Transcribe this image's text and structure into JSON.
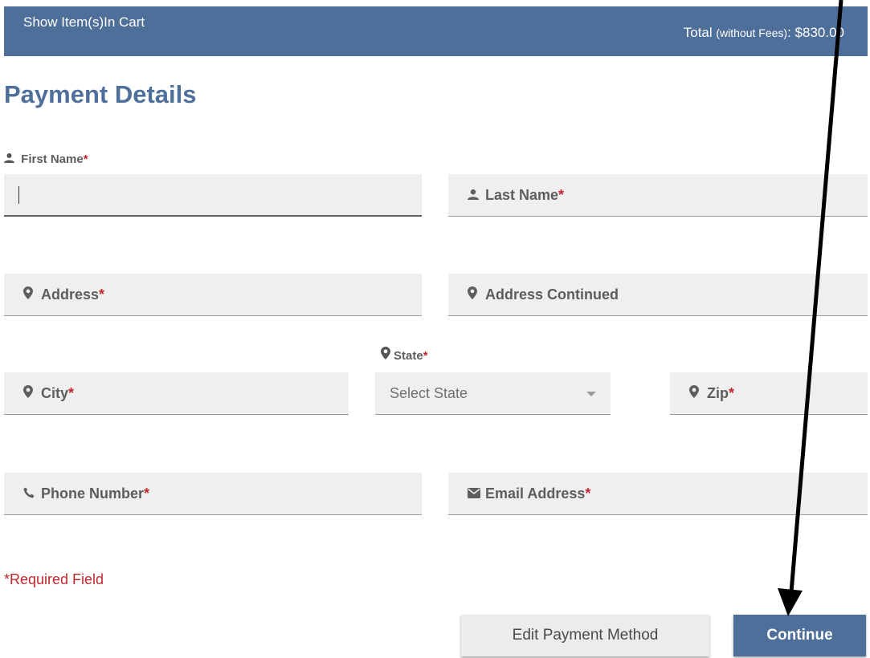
{
  "cart": {
    "show_items_label": "Show Item(s)In Cart",
    "total_label": "Total ",
    "total_qualifier": "(without Fees)",
    "total_value": ": $830.00"
  },
  "page_title": "Payment Details",
  "required_marker": "*",
  "form": {
    "first_name_label": "First Name",
    "first_name_value": "",
    "last_name_placeholder": "Last Name",
    "address_placeholder": "Address",
    "address_continued_placeholder": "Address Continued",
    "state_label": "State",
    "state_selected": "Select State",
    "city_placeholder": "City",
    "zip_placeholder": "Zip",
    "phone_placeholder": "Phone Number",
    "email_placeholder": "Email Address"
  },
  "required_note": "*Required Field",
  "buttons": {
    "edit_payment_method": "Edit Payment Method",
    "continue": "Continue"
  },
  "icons": {
    "person": "person-icon",
    "location": "location-pin-icon",
    "phone": "phone-icon",
    "email": "envelope-icon"
  },
  "colors": {
    "brand": "#4e6f9a",
    "required": "#c0282f",
    "field_bg": "#efefef"
  }
}
